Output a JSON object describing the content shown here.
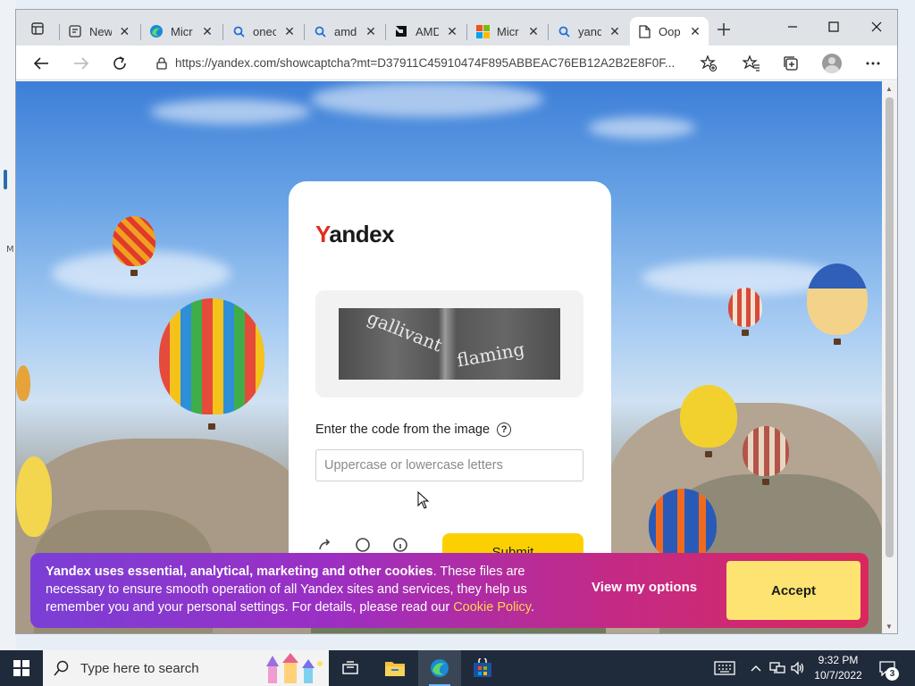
{
  "browser": {
    "tabs": [
      {
        "label": "New",
        "icon": "new-tab-page-icon"
      },
      {
        "label": "Micr",
        "icon": "edge-icon"
      },
      {
        "label": "onec",
        "icon": "search-icon"
      },
      {
        "label": "amd",
        "icon": "search-icon"
      },
      {
        "label": "AMD",
        "icon": "amd-logo-icon"
      },
      {
        "label": "Micr",
        "icon": "microsoft-logo-icon"
      },
      {
        "label": "yand",
        "icon": "search-icon"
      },
      {
        "label": "Oop",
        "icon": "page-icon",
        "active": true
      }
    ],
    "close_glyph": "✕",
    "url": "https://yandex.com/showcaptcha?mt=D37911C45910474F895ABBEAC76EB12A2B2E8F0F..."
  },
  "captcha": {
    "logo_first": "Y",
    "logo_rest": "andex",
    "captcha_words": [
      "gallivant",
      "flaming"
    ],
    "input_label": "Enter the code from the image",
    "input_placeholder": "Uppercase or lowercase letters",
    "submit_label": "Submit"
  },
  "cookie": {
    "bold": "Yandex uses essential, analytical, marketing and other cookies",
    "text": ". These files are necessary to ensure smooth operation of all Yandex sites and services, they help us remember you and your personal settings. For details, please read our ",
    "link": "Cookie Policy",
    "tail": ".",
    "view_options": "View my options",
    "accept": "Accept"
  },
  "desktop": {
    "left_letter": "M"
  },
  "taskbar": {
    "search_placeholder": "Type here to search",
    "time": "9:32 PM",
    "date": "10/7/2022",
    "notification_count": "3"
  },
  "colors": {
    "yandex_red": "#e12d1f",
    "submit_yellow": "#fcd000",
    "accept_yellow": "#fde371",
    "cookie_link": "#ffd34d"
  }
}
